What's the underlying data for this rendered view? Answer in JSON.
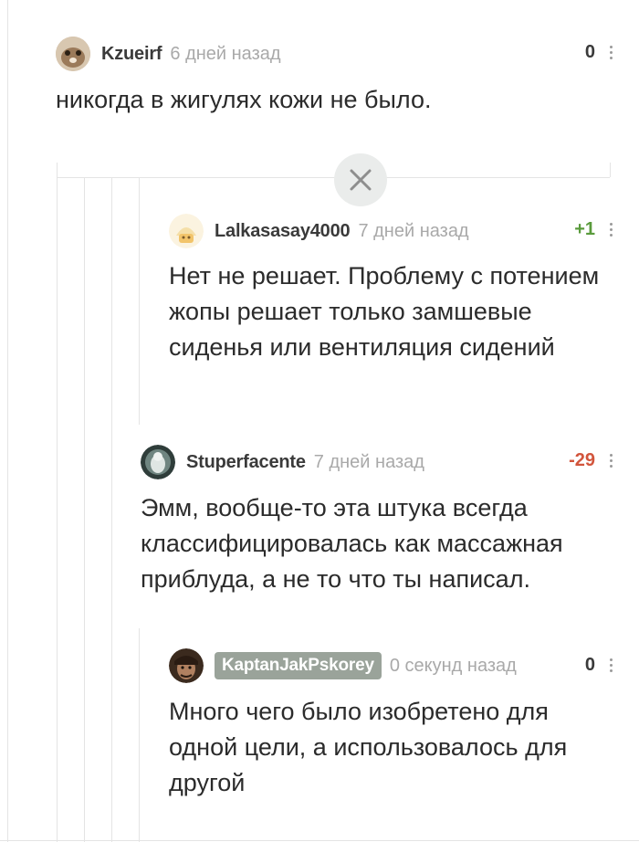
{
  "comments": [
    {
      "author": "Kzueirf",
      "time": "6 дней назад",
      "rating": "0",
      "text": "никогда в жигулях кожи не было."
    },
    {
      "author": "Lalkasasay4000",
      "time": "7 дней назад",
      "rating": "+1",
      "text": "Нет не решает. Проблему с потением жопы решает только замшевые сиденья или вентиляция сидений"
    },
    {
      "author": "Stuperfacente",
      "time": "7 дней назад",
      "rating": "-29",
      "text": "Эмм, вообще-то эта штука  всегда классифицировалась как массажная приблуда, а не то что ты написал."
    },
    {
      "author": "KaptanJakPskorey",
      "time": "0 секунд назад",
      "rating": "0",
      "text": "Много чего было изобретено для одной цели, а использовалось для другой"
    }
  ],
  "colors": {
    "positive": "#5a9b3c",
    "negative": "#d2553c",
    "neutral": "#3a3a3a",
    "author_highlight_bg": "#9aa39a"
  },
  "icons": {
    "close": "close-icon",
    "more": "more-vertical-icon"
  }
}
